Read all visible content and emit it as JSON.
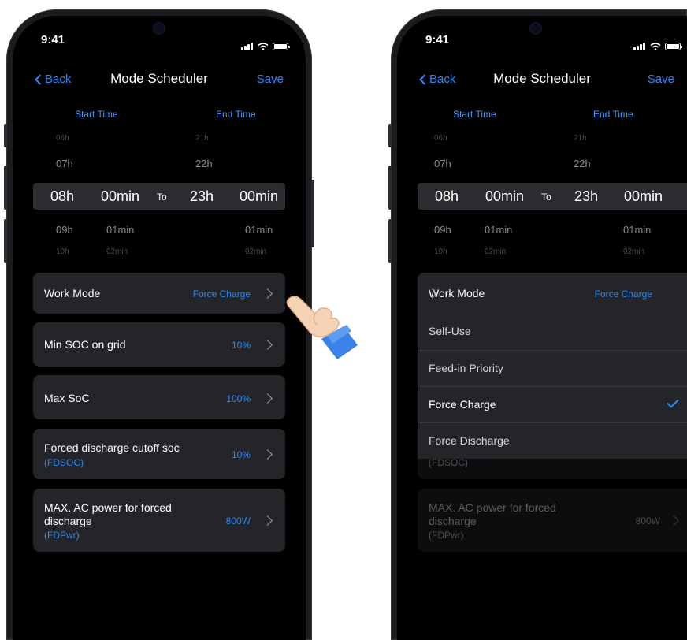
{
  "status": {
    "time": "9:41"
  },
  "nav": {
    "back": "Back",
    "title": "Mode Scheduler",
    "save": "Save"
  },
  "picker": {
    "start_label": "Start Time",
    "end_label": "End Time",
    "row1": {
      "sh": "06h",
      "eh": "21h"
    },
    "row2": {
      "sh": "07h",
      "eh": "22h"
    },
    "selected": {
      "sh": "08h",
      "sm": "00min",
      "to": "To",
      "eh": "23h",
      "em": "00min"
    },
    "row4": {
      "sh": "09h",
      "sm": "01min",
      "em": "01min"
    },
    "row5": {
      "sh": "10h",
      "sm": "02min",
      "em": "02min"
    }
  },
  "settings": {
    "work_mode": {
      "label": "Work Mode",
      "value": "Force Charge"
    },
    "min_soc": {
      "label": "Min SOC on grid",
      "value": "10%"
    },
    "max_soc": {
      "label": "Max SoC",
      "value": "100%"
    },
    "fdsoc": {
      "label": "Forced discharge cutoff soc",
      "sub": "(FDSOC)",
      "value": "10%"
    },
    "fdpwr": {
      "label1": "MAX. AC power for forced",
      "label2": "discharge",
      "sub": "(FDPwr)",
      "value": "800W"
    }
  },
  "dropdown": {
    "options": [
      "Self-Use",
      "Feed-in Priority",
      "Force Charge",
      "Force Discharge"
    ],
    "selected_index": 2
  },
  "colors": {
    "accent": "#2f86f6",
    "card": "#242528",
    "background": "#000000"
  },
  "icons": [
    "chevron-left-icon",
    "signal-icon",
    "wifi-icon",
    "battery-icon",
    "chevron-right-icon",
    "checkmark-icon",
    "pointing-hand-icon"
  ]
}
